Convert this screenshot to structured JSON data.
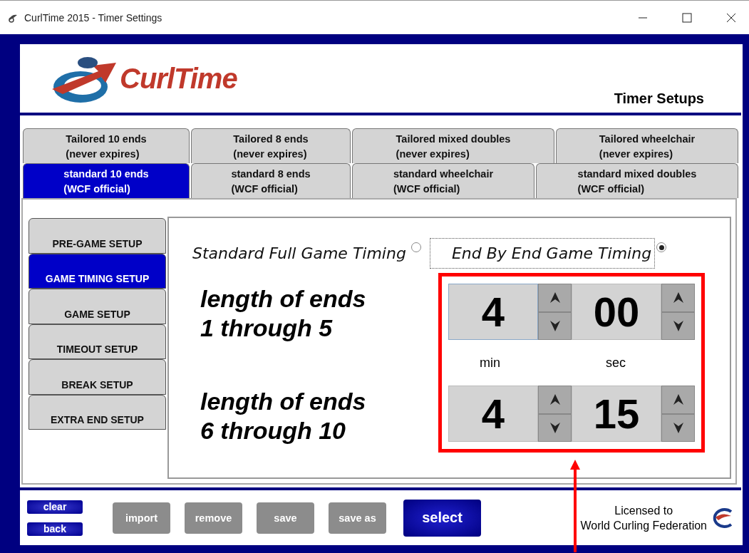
{
  "window": {
    "title": "CurlTime 2015 - Timer Settings"
  },
  "header": {
    "logo_text": "CurlTime",
    "title": "Timer Setups"
  },
  "tab_rows": [
    [
      {
        "label": "Tailored 10 ends",
        "sublabel": "(never expires)",
        "selected": false
      },
      {
        "label": "Tailored 8 ends",
        "sublabel": "(never expires)",
        "selected": false
      },
      {
        "label": "Tailored mixed doubles",
        "sublabel": "(never expires)",
        "selected": false
      },
      {
        "label": "Tailored wheelchair",
        "sublabel": "(never expires)",
        "selected": false
      }
    ],
    [
      {
        "label": "standard 10 ends",
        "sublabel": "(WCF official)",
        "selected": true
      },
      {
        "label": "standard 8 ends",
        "sublabel": "(WCF official)",
        "selected": false
      },
      {
        "label": "standard wheelchair",
        "sublabel": "(WCF official)",
        "selected": false
      },
      {
        "label": "standard mixed doubles",
        "sublabel": "(WCF official)",
        "selected": false
      }
    ]
  ],
  "side_menu": [
    {
      "label": "PRE-GAME SETUP",
      "selected": false
    },
    {
      "label": "GAME TIMING SETUP",
      "selected": true
    },
    {
      "label": "GAME SETUP",
      "selected": false
    },
    {
      "label": "TIMEOUT SETUP",
      "selected": false
    },
    {
      "label": "BREAK SETUP",
      "selected": false
    },
    {
      "label": "EXTRA END SETUP",
      "selected": false
    }
  ],
  "timing_options": [
    {
      "label": "Standard Full Game Timing",
      "selected": false
    },
    {
      "label": "End By End Game Timing",
      "selected": true
    }
  ],
  "end_groups": [
    {
      "label_line1": "length of ends",
      "label_line2": "1 through 5",
      "minutes": "4",
      "seconds": "00"
    },
    {
      "label_line1": "length of ends",
      "label_line2": "6 through 10",
      "minutes": "4",
      "seconds": "15"
    }
  ],
  "units": {
    "minutes": "min",
    "seconds": "sec"
  },
  "small_buttons": [
    "clear",
    "back"
  ],
  "buttons": [
    {
      "label": "import",
      "disabled": true
    },
    {
      "label": "remove",
      "disabled": true
    },
    {
      "label": "save",
      "disabled": true
    },
    {
      "label": "save as",
      "disabled": true
    }
  ],
  "primary_button": "select",
  "license": {
    "line1": "Licensed to",
    "line2": "World Curling Federation"
  }
}
